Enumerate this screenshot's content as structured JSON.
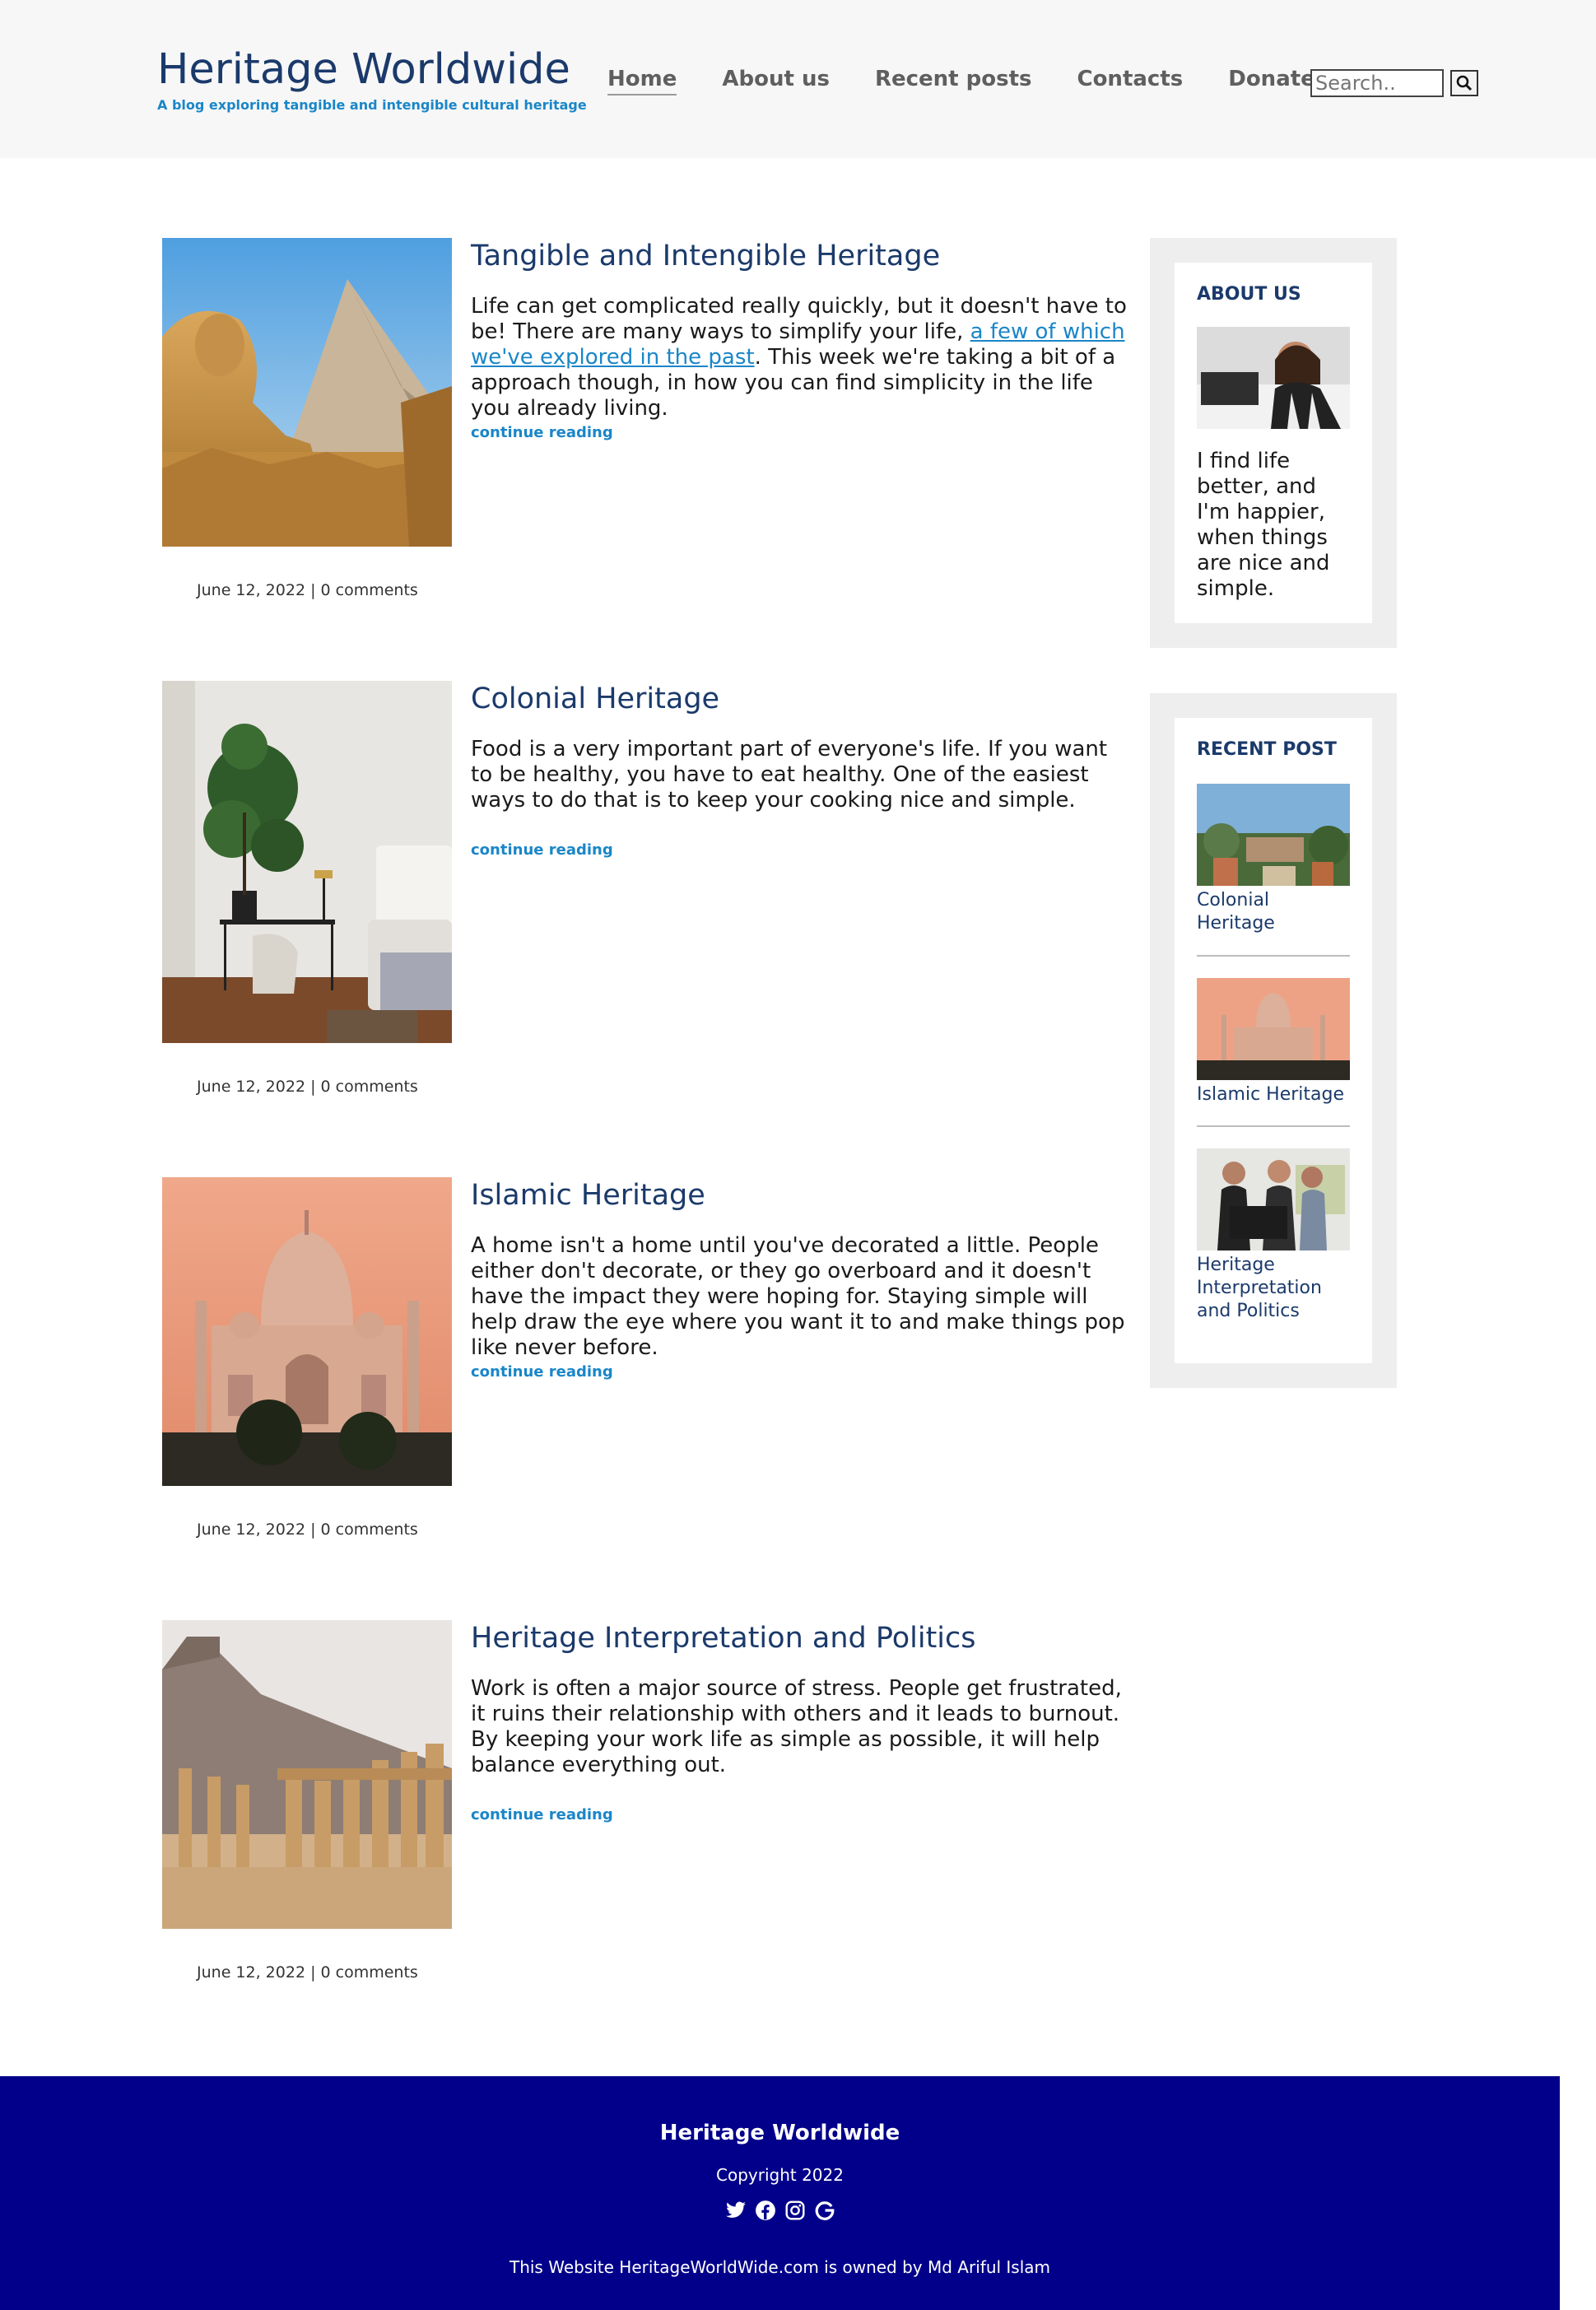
{
  "header": {
    "title": "Heritage Worldwide",
    "tagline": "A blog exploring tangible and intengible cultural heritage",
    "nav": [
      "Home",
      "About us",
      "Recent posts",
      "Contacts",
      "Donates"
    ],
    "search_placeholder": "Search..",
    "search_icon": "search-icon"
  },
  "posts": [
    {
      "title": "Tangible and Intengible Heritage",
      "excerpt_before": "Life can get complicated really quickly, but it doesn't have to be! There are many ways to simplify your life, ",
      "excerpt_link": "a few of which we've explored in the past",
      "excerpt_after": ". This week we're taking a bit of a approach though, in how you can find simplicity in the life you already living.",
      "read_more": "continue reading",
      "meta": "June 12, 2022 | 0 comments",
      "image": "sphinx-and-pyramid"
    },
    {
      "title": "Colonial Heritage",
      "excerpt": "Food is a very important part of everyone's life. If you want to be healthy, you have to eat healthy. One of the easiest ways to do that is to keep your cooking nice and simple.",
      "read_more": "continue reading",
      "meta": "June 12, 2022 | 0 comments",
      "image": "room-interior-with-plant"
    },
    {
      "title": "Islamic Heritage",
      "excerpt": "A home isn't a home until you've decorated a little. People either don't decorate, or they go overboard and it doesn't have the impact they were hoping for. Staying simple will help draw the eye where you want it to and make things pop like never before.",
      "read_more": "continue reading",
      "meta": "June 12, 2022 | 0 comments",
      "image": "taj-mahal"
    },
    {
      "title": "Heritage Interpretation and Politics",
      "excerpt": "Work is often a major source of stress. People get frustrated, it ruins their relationship with others and it leads to burnout. By keeping your work life as simple as possible, it will help balance everything out.",
      "read_more": "continue reading",
      "meta": "June 12, 2022 | 0 comments",
      "image": "ancient-ruins"
    }
  ],
  "sidebar": {
    "about": {
      "title": "ABOUT US",
      "text": "I find life better, and I'm happier, when things are nice and simple.",
      "image": "woman-at-desk"
    },
    "recent": {
      "title": "RECENT POST",
      "items": [
        {
          "label": "Colonial Heritage",
          "image": "colonial-street"
        },
        {
          "label": "Islamic Heritage",
          "image": "taj-mahal"
        },
        {
          "label": "Heritage Interpretation and Politics",
          "image": "people-at-computer"
        }
      ]
    }
  },
  "footer": {
    "title": "Heritage Worldwide",
    "copyright": "Copyright 2022",
    "icons": [
      "twitter-icon",
      "facebook-icon",
      "instagram-icon",
      "google-icon"
    ],
    "owner": "This Website HeritageWorldWide.com is owned by Md Ariful Islam"
  },
  "colors": {
    "brand": "#1b3a6b",
    "link": "#1a86c8",
    "footer_bg": "#02008a",
    "header_bg": "#f7f7f7"
  }
}
